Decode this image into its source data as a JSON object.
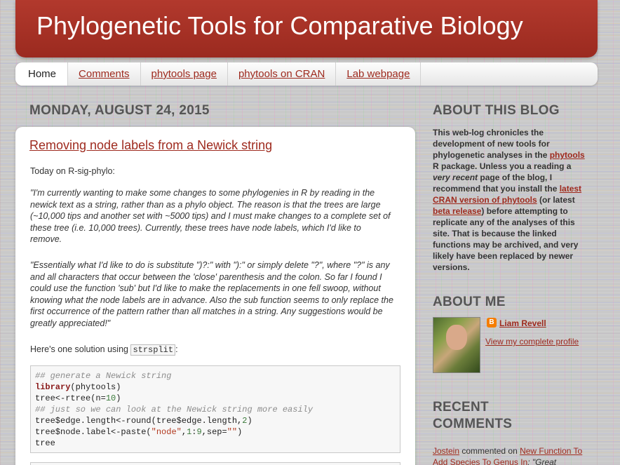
{
  "header": {
    "title": "Phylogenetic Tools for Comparative Biology"
  },
  "tabs": [
    {
      "label": "Home",
      "active": true
    },
    {
      "label": "Comments"
    },
    {
      "label": "phytools page"
    },
    {
      "label": "phytools on CRAN"
    },
    {
      "label": "Lab webpage"
    }
  ],
  "post": {
    "date": "MONDAY, AUGUST 24, 2015",
    "title": "Removing node labels from a Newick string",
    "intro": "Today on R-sig-phylo:",
    "quote1": "\"I'm currently wanting to make some changes to some phylogenies in R by reading in the newick text as a string, rather than as a phylo object. The reason is that the trees are large (~10,000 tips and another set with ~5000 tips) and I must make changes to a complete set of these tree (i.e. 10,000 trees). Currently, these trees have node labels, which I'd like to remove.",
    "quote2": "\"Essentially what I'd like to do is substitute \")?:\" with \"):\" or simply delete \"?\", where \"?\" is any and all characters that occur between the 'close' parenthesis and the colon. So far I found I could use the function 'sub' but I'd like to make the replacements in one fell swoop, without knowing what the node labels are in advance. Also the sub function seems to only replace the first occurrence of the pattern rather than all matches in a string. Any suggestions would be greatly appreciated!\"",
    "solution_prefix": "Here's one solution using ",
    "solution_code": "strsplit",
    "solution_suffix": ":",
    "code": {
      "c1": "## generate a Newick string",
      "l2_kw": "library",
      "l2_rest": "(phytools)",
      "l3_a": "tree<-rtree(n=",
      "l3_num": "10",
      "l3_b": ")",
      "c4": "## just so we can look at the Newick string more easily",
      "l5_a": "tree$edge.length<-round(tree$edge.length,",
      "l5_num": "2",
      "l5_b": ")",
      "l6_a": "tree$node.label<-paste(",
      "l6_str": "\"node\"",
      "l6_b": ",",
      "l6_num1": "1",
      "l6_c": ":",
      "l6_num2": "9",
      "l6_d": ",sep=",
      "l6_str2": "\"\"",
      "l6_e": ")",
      "l7": "tree"
    }
  },
  "sidebar": {
    "about_blog": {
      "heading": "ABOUT THIS BLOG",
      "t1": "This web-log chronicles the development of new tools for phylogenetic analyses in the ",
      "link1": "phytools",
      "t2": " R package. Unless you a reading a ",
      "em1": "very recent",
      "t3": " page of the blog, I recommend that you install the ",
      "link2": "latest CRAN version of phytools",
      "t4": " (or latest ",
      "link3": "beta release",
      "t5": ") before attempting to replicate any of the analyses of this site. That is because the linked functions may be archived, and very likely have been replaced by newer versions."
    },
    "about_me": {
      "heading": "ABOUT ME",
      "name": "Liam Revell",
      "profile_link": "View my complete profile"
    },
    "recent_comments": {
      "heading_line1": "RECENT",
      "heading_line2": "COMMENTS",
      "author": "Jostein",
      "mid": " commented on ",
      "post_link": "New Function To Add Species To Genus In",
      "snippet": ": \"Great"
    }
  }
}
